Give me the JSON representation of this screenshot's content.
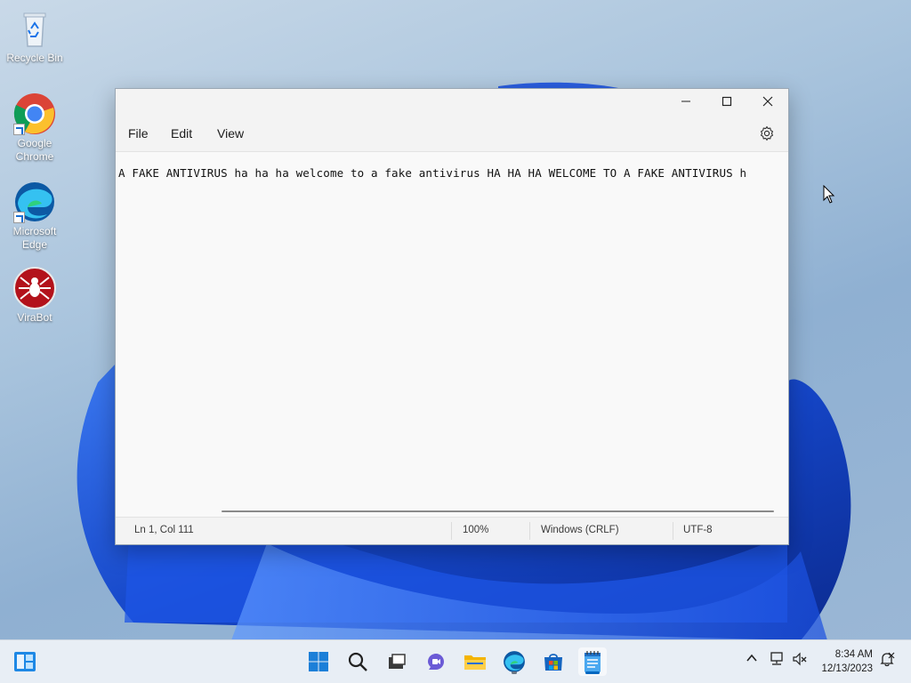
{
  "desktop": {
    "icons": [
      {
        "label": "Recycle Bin",
        "icon": "recycle-bin-icon"
      },
      {
        "label": "Google Chrome",
        "icon": "chrome-icon"
      },
      {
        "label": "Microsoft Edge",
        "icon": "edge-icon"
      },
      {
        "label": "ViraBot",
        "icon": "virabot-icon"
      }
    ]
  },
  "notepad": {
    "menu": {
      "file": "File",
      "edit": "Edit",
      "view": "View"
    },
    "content": "A FAKE ANTIVIRUS ha ha ha welcome to a fake antivirus HA HA HA WELCOME TO A FAKE ANTIVIRUS h",
    "status": {
      "position": "Ln 1, Col 111",
      "zoom": "100%",
      "line_ending": "Windows (CRLF)",
      "encoding": "UTF-8"
    }
  },
  "taskbar": {
    "apps": [
      "start-icon",
      "search-icon",
      "task-view-icon",
      "chat-icon",
      "file-explorer-icon",
      "edge-icon",
      "store-icon",
      "notepad-icon"
    ],
    "clock": {
      "time": "8:34 AM",
      "date": "12/13/2023"
    }
  },
  "colors": {
    "accent": "#0067c0",
    "wallpaper_bloom": "#1e4fd6"
  }
}
